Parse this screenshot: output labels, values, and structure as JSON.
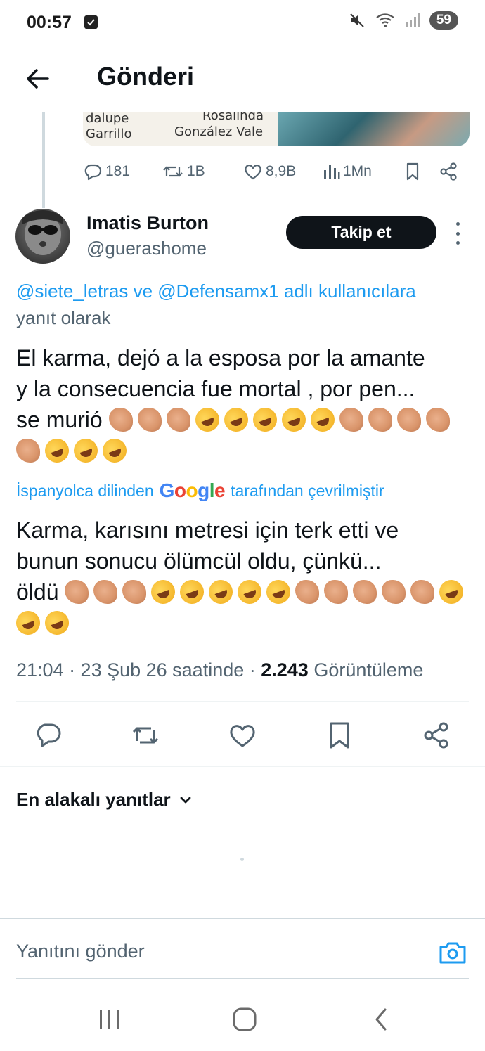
{
  "status_bar": {
    "time": "00:57",
    "battery": "59",
    "icons": [
      "check-notification-icon",
      "mute-icon",
      "wifi-icon",
      "signal-icon"
    ]
  },
  "header": {
    "title": "Gönderi",
    "back_icon": "arrow-left-icon"
  },
  "quoted_image": {
    "text_left_1": "dalupe",
    "text_left_2": "Garrillo",
    "text_mid_1": "Rosalinda",
    "text_mid_2": "González Vale"
  },
  "previous_tweet_actions": {
    "replies": "181",
    "retweets": "1B",
    "likes": "8,9B",
    "views": "1Mn"
  },
  "tweet": {
    "author_name": "Imatis Burton",
    "author_handle": "@guerashome",
    "follow_label": "Takip et",
    "reply_mention_1": "@siete_letras",
    "reply_joiner": " ve ",
    "reply_mention_2": "@Defensamx1",
    "reply_suffix_colored": " adlı kullanıcılara",
    "reply_suffix": "yanıt olarak",
    "text_line1": "El karma, dejó  a la esposa por la amante",
    "text_line2": "y la consecuencia fue mortal , por pen...",
    "text_line3": "se murió",
    "translated_prefix": "İspanyolca dilinden",
    "translated_brand": "Google",
    "translated_suffix": "tarafından çevrilmiştir",
    "translated_line1": "Karma, karısını metresi için terk etti ve",
    "translated_line2": "bunun sonucu ölümcül oldu, çünkü...",
    "translated_line3": "öldü",
    "timestamp": "21:04 · 23 Şub 26 saatinde · ",
    "views_count": "2.243",
    "views_label": " Görüntüleme"
  },
  "replies_section": {
    "sort_label": "En alakalı yanıtlar"
  },
  "compose": {
    "placeholder": "Yanıtını gönder"
  },
  "colors": {
    "accent": "#1d9bf0",
    "text": "#0f1419",
    "secondary": "#536471"
  }
}
